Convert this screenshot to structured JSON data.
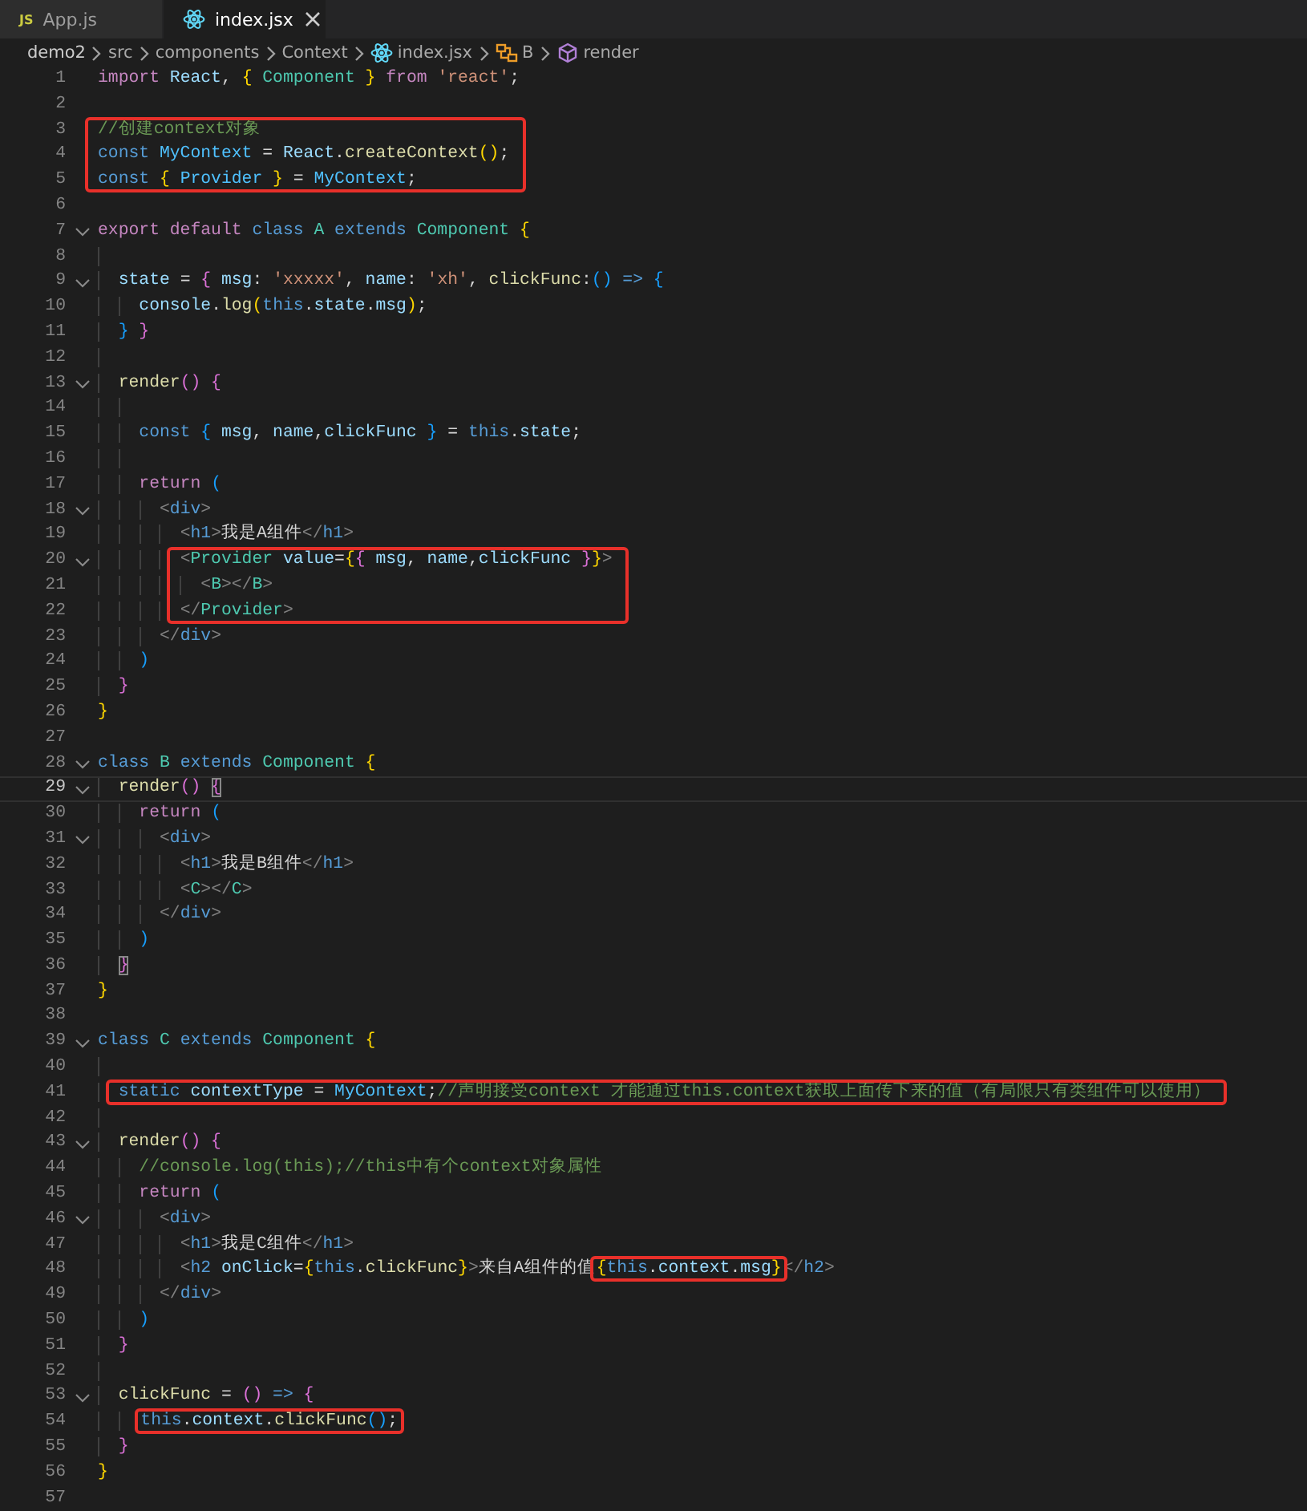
{
  "tabs": [
    {
      "kind": "js",
      "icon_text": "JS",
      "label": "App.js",
      "selected": false
    },
    {
      "kind": "react",
      "label": "index.jsx",
      "selected": true
    }
  ],
  "breadcrumb": [
    {
      "text": "demo2"
    },
    {
      "text": "src"
    },
    {
      "text": "components"
    },
    {
      "text": "Context"
    },
    {
      "kind": "react",
      "text": "index.jsx"
    },
    {
      "kind": "class",
      "text": "B"
    },
    {
      "kind": "method",
      "text": "render"
    }
  ],
  "blocks": [
    {
      "boxed": false,
      "lines": [
        {
          "number": "1",
          "tokens": [
            {
              "kind": "ctl",
              "text": "import "
            },
            {
              "kind": "var",
              "text": "React"
            },
            {
              "kind": "p",
              "text": ", "
            },
            {
              "kind": "b1",
              "text": "{ "
            },
            {
              "kind": "type",
              "text": "Component"
            },
            {
              "kind": "b1",
              "text": " }"
            },
            {
              "kind": "ctl",
              "text": " from "
            },
            {
              "kind": "str",
              "text": "'react'"
            },
            {
              "kind": "p",
              "text": ";"
            }
          ]
        },
        {
          "number": "2"
        }
      ]
    },
    {
      "boxed": true,
      "lines": [
        {
          "number": "3",
          "tokens": [
            {
              "kind": "cmt",
              "text": "//创建context对象"
            }
          ]
        },
        {
          "number": "4",
          "tokens": [
            {
              "kind": "kw",
              "text": "const "
            },
            {
              "kind": "const",
              "text": "MyContext"
            },
            {
              "kind": "p",
              "text": " = "
            },
            {
              "kind": "var",
              "text": "React"
            },
            {
              "kind": "p",
              "text": "."
            },
            {
              "kind": "fn",
              "text": "createContext"
            },
            {
              "kind": "b1",
              "text": "()"
            },
            {
              "kind": "p",
              "text": ";"
            }
          ]
        },
        {
          "number": "5",
          "tokens": [
            {
              "kind": "kw",
              "text": "const "
            },
            {
              "kind": "b1",
              "text": "{ "
            },
            {
              "kind": "const",
              "text": "Provider"
            },
            {
              "kind": "b1",
              "text": " }"
            },
            {
              "kind": "p",
              "text": " = "
            },
            {
              "kind": "const",
              "text": "MyContext"
            },
            {
              "kind": "p",
              "text": ";"
            }
          ]
        }
      ]
    },
    {
      "boxed": false,
      "lines": [
        {
          "number": "6"
        },
        {
          "number": "7",
          "foldable": true,
          "tokens": [
            {
              "kind": "ctl",
              "text": "export default "
            },
            {
              "kind": "kw",
              "text": "class "
            },
            {
              "kind": "type",
              "text": "A"
            },
            {
              "kind": "kw",
              "text": " extends "
            },
            {
              "kind": "type",
              "text": "Component"
            },
            {
              "kind": "b1",
              "text": " {"
            }
          ]
        },
        {
          "number": "8"
        },
        {
          "number": "9",
          "foldable": true,
          "tokens": [
            {
              "kind": "var",
              "text": "  state"
            },
            {
              "kind": "p",
              "text": " = "
            },
            {
              "kind": "b2",
              "text": "{ "
            },
            {
              "kind": "var",
              "text": "msg"
            },
            {
              "kind": "p",
              "text": ": "
            },
            {
              "kind": "str",
              "text": "'xxxxx'"
            },
            {
              "kind": "p",
              "text": ", "
            },
            {
              "kind": "var",
              "text": "name"
            },
            {
              "kind": "p",
              "text": ": "
            },
            {
              "kind": "str",
              "text": "'xh'"
            },
            {
              "kind": "p",
              "text": ", "
            },
            {
              "kind": "fn",
              "text": "clickFunc"
            },
            {
              "kind": "p",
              "text": ":"
            },
            {
              "kind": "b3",
              "text": "()"
            },
            {
              "kind": "kw",
              "text": " => "
            },
            {
              "kind": "b3",
              "text": "{"
            }
          ]
        },
        {
          "number": "10",
          "tokens": [
            {
              "kind": "var",
              "text": "    console"
            },
            {
              "kind": "p",
              "text": "."
            },
            {
              "kind": "fn",
              "text": "log"
            },
            {
              "kind": "b1",
              "text": "("
            },
            {
              "kind": "kw",
              "text": "this"
            },
            {
              "kind": "p",
              "text": "."
            },
            {
              "kind": "var",
              "text": "state"
            },
            {
              "kind": "p",
              "text": "."
            },
            {
              "kind": "var",
              "text": "msg"
            },
            {
              "kind": "b1",
              "text": ")"
            },
            {
              "kind": "p",
              "text": ";"
            }
          ]
        },
        {
          "number": "11",
          "tokens": [
            {
              "kind": "b3",
              "text": "  } "
            },
            {
              "kind": "b2",
              "text": "}"
            }
          ]
        },
        {
          "number": "12"
        },
        {
          "number": "13",
          "foldable": true,
          "tokens": [
            {
              "kind": "fn",
              "text": "  render"
            },
            {
              "kind": "b2",
              "text": "() {"
            }
          ]
        },
        {
          "number": "14"
        },
        {
          "number": "15",
          "tokens": [
            {
              "kind": "kw",
              "text": "    const "
            },
            {
              "kind": "b3",
              "text": "{ "
            },
            {
              "kind": "var",
              "text": "msg"
            },
            {
              "kind": "p",
              "text": ", "
            },
            {
              "kind": "var",
              "text": "name"
            },
            {
              "kind": "p",
              "text": ","
            },
            {
              "kind": "var",
              "text": "clickFunc"
            },
            {
              "kind": "b3",
              "text": " }"
            },
            {
              "kind": "p",
              "text": " = "
            },
            {
              "kind": "kw",
              "text": "this"
            },
            {
              "kind": "p",
              "text": "."
            },
            {
              "kind": "var",
              "text": "state"
            },
            {
              "kind": "p",
              "text": ";"
            }
          ]
        },
        {
          "number": "16"
        },
        {
          "number": "17",
          "tokens": [
            {
              "kind": "ctl",
              "text": "    return "
            },
            {
              "kind": "b3",
              "text": "("
            }
          ]
        },
        {
          "number": "18",
          "foldable": true,
          "tokens": [
            {
              "kind": "ang",
              "text": "      <"
            },
            {
              "kind": "tag",
              "text": "div"
            },
            {
              "kind": "ang",
              "text": ">"
            }
          ]
        },
        {
          "number": "19",
          "tokens": [
            {
              "kind": "ang",
              "text": "        <"
            },
            {
              "kind": "tag",
              "text": "h1"
            },
            {
              "kind": "ang",
              "text": ">"
            },
            {
              "kind": "text",
              "text": "我是A组件"
            },
            {
              "kind": "ang",
              "text": "</"
            },
            {
              "kind": "tag",
              "text": "h1"
            },
            {
              "kind": "ang",
              "text": ">"
            }
          ]
        }
      ]
    },
    {
      "boxed": true,
      "lines": [
        {
          "number": "20",
          "foldable": true,
          "tokens": [
            {
              "kind": "ang",
              "text": "        <"
            },
            {
              "kind": "type",
              "text": "Provider "
            },
            {
              "kind": "var",
              "text": "value"
            },
            {
              "kind": "p",
              "text": "="
            },
            {
              "kind": "b1",
              "text": "{"
            },
            {
              "kind": "b2",
              "text": "{ "
            },
            {
              "kind": "var",
              "text": "msg"
            },
            {
              "kind": "p",
              "text": ", "
            },
            {
              "kind": "var",
              "text": "name"
            },
            {
              "kind": "p",
              "text": ","
            },
            {
              "kind": "var",
              "text": "clickFunc"
            },
            {
              "kind": "b2",
              "text": " }"
            },
            {
              "kind": "b1",
              "text": "}"
            },
            {
              "kind": "ang",
              "text": ">"
            }
          ]
        },
        {
          "number": "21",
          "tokens": [
            {
              "kind": "ang",
              "text": "          <"
            },
            {
              "kind": "type",
              "text": "B"
            },
            {
              "kind": "ang",
              "text": "></"
            },
            {
              "kind": "type",
              "text": "B"
            },
            {
              "kind": "ang",
              "text": ">"
            }
          ]
        },
        {
          "number": "22",
          "tokens": [
            {
              "kind": "ang",
              "text": "        </"
            },
            {
              "kind": "type",
              "text": "Provider"
            },
            {
              "kind": "ang",
              "text": ">"
            }
          ]
        }
      ]
    },
    {
      "boxed": false,
      "lines": [
        {
          "number": "23",
          "tokens": [
            {
              "kind": "ang",
              "text": "      </"
            },
            {
              "kind": "tag",
              "text": "div"
            },
            {
              "kind": "ang",
              "text": ">"
            }
          ]
        },
        {
          "number": "24",
          "tokens": [
            {
              "kind": "b3",
              "text": "    )"
            }
          ]
        },
        {
          "number": "25",
          "tokens": [
            {
              "kind": "b2",
              "text": "  }"
            }
          ]
        },
        {
          "number": "26",
          "tokens": [
            {
              "kind": "b1",
              "text": "}"
            }
          ]
        },
        {
          "number": "27"
        },
        {
          "number": "28",
          "foldable": true,
          "tokens": [
            {
              "kind": "kw",
              "text": "class "
            },
            {
              "kind": "type",
              "text": "B"
            },
            {
              "kind": "kw",
              "text": " extends "
            },
            {
              "kind": "type",
              "text": "Component"
            },
            {
              "kind": "b1",
              "text": " {"
            }
          ]
        },
        {
          "number": "29",
          "foldable": true,
          "current": true,
          "tokens": [
            {
              "kind": "fn",
              "text": "  render"
            },
            {
              "kind": "b2",
              "text": "() "
            },
            {
              "kind": "b2",
              "text": "{",
              "matched": true
            }
          ]
        },
        {
          "number": "30",
          "tokens": [
            {
              "kind": "ctl",
              "text": "    return "
            },
            {
              "kind": "b3",
              "text": "("
            }
          ]
        },
        {
          "number": "31",
          "foldable": true,
          "tokens": [
            {
              "kind": "ang",
              "text": "      <"
            },
            {
              "kind": "tag",
              "text": "div"
            },
            {
              "kind": "ang",
              "text": ">"
            }
          ]
        },
        {
          "number": "32",
          "tokens": [
            {
              "kind": "ang",
              "text": "        <"
            },
            {
              "kind": "tag",
              "text": "h1"
            },
            {
              "kind": "ang",
              "text": ">"
            },
            {
              "kind": "text",
              "text": "我是B组件"
            },
            {
              "kind": "ang",
              "text": "</"
            },
            {
              "kind": "tag",
              "text": "h1"
            },
            {
              "kind": "ang",
              "text": ">"
            }
          ]
        },
        {
          "number": "33",
          "tokens": [
            {
              "kind": "ang",
              "text": "        <"
            },
            {
              "kind": "type",
              "text": "C"
            },
            {
              "kind": "ang",
              "text": "></"
            },
            {
              "kind": "type",
              "text": "C"
            },
            {
              "kind": "ang",
              "text": ">"
            }
          ]
        },
        {
          "number": "34",
          "tokens": [
            {
              "kind": "ang",
              "text": "      </"
            },
            {
              "kind": "tag",
              "text": "div"
            },
            {
              "kind": "ang",
              "text": ">"
            }
          ]
        },
        {
          "number": "35",
          "tokens": [
            {
              "kind": "b3",
              "text": "    )"
            }
          ]
        },
        {
          "number": "36",
          "tokens": [
            {
              "kind": "b2",
              "text": "  }",
              "matched": true
            }
          ]
        },
        {
          "number": "37",
          "tokens": [
            {
              "kind": "b1",
              "text": "}"
            }
          ]
        },
        {
          "number": "38"
        },
        {
          "number": "39",
          "foldable": true,
          "tokens": [
            {
              "kind": "kw",
              "text": "class "
            },
            {
              "kind": "type",
              "text": "C"
            },
            {
              "kind": "kw",
              "text": " extends "
            },
            {
              "kind": "type",
              "text": "Component"
            },
            {
              "kind": "b1",
              "text": " {"
            }
          ]
        },
        {
          "number": "40"
        }
      ]
    },
    {
      "boxed": true,
      "lines": [
        {
          "number": "41",
          "tokens": [
            {
              "kind": "kw",
              "text": "  static "
            },
            {
              "kind": "var",
              "text": "contextType"
            },
            {
              "kind": "p",
              "text": " = "
            },
            {
              "kind": "const",
              "text": "MyContext"
            },
            {
              "kind": "p",
              "text": ";"
            },
            {
              "kind": "cmt",
              "text": "//声明接受context 才能通过this.context获取上面传下来的值（有局限只有类组件可以使用）"
            }
          ]
        }
      ]
    },
    {
      "boxed": false,
      "lines": [
        {
          "number": "42"
        },
        {
          "number": "43",
          "foldable": true,
          "tokens": [
            {
              "kind": "fn",
              "text": "  render"
            },
            {
              "kind": "b2",
              "text": "() {"
            }
          ]
        },
        {
          "number": "44",
          "tokens": [
            {
              "kind": "cmt",
              "text": "    //console.log(this);//this中有个context对象属性"
            }
          ]
        },
        {
          "number": "45",
          "tokens": [
            {
              "kind": "ctl",
              "text": "    return "
            },
            {
              "kind": "b3",
              "text": "("
            }
          ]
        },
        {
          "number": "46",
          "foldable": true,
          "tokens": [
            {
              "kind": "ang",
              "text": "      <"
            },
            {
              "kind": "tag",
              "text": "div"
            },
            {
              "kind": "ang",
              "text": ">"
            }
          ]
        },
        {
          "number": "47",
          "tokens": [
            {
              "kind": "ang",
              "text": "        <"
            },
            {
              "kind": "tag",
              "text": "h1"
            },
            {
              "kind": "ang",
              "text": ">"
            },
            {
              "kind": "text",
              "text": "我是C组件"
            },
            {
              "kind": "ang",
              "text": "</"
            },
            {
              "kind": "tag",
              "text": "h1"
            },
            {
              "kind": "ang",
              "text": ">"
            }
          ]
        },
        {
          "number": "48",
          "tokens": [
            {
              "kind": "ang",
              "text": "        <"
            },
            {
              "kind": "tag",
              "text": "h2 "
            },
            {
              "kind": "var",
              "text": "onClick"
            },
            {
              "kind": "p",
              "text": "="
            },
            {
              "kind": "b1",
              "text": "{"
            },
            {
              "kind": "kw",
              "text": "this"
            },
            {
              "kind": "p",
              "text": "."
            },
            {
              "kind": "fn",
              "text": "clickFunc"
            },
            {
              "kind": "b1",
              "text": "}"
            },
            {
              "kind": "ang",
              "text": ">"
            },
            {
              "kind": "text",
              "text": "来自A组件的值"
            },
            {
              "kind": "group",
              "boxed": true,
              "tokens": [
                {
                  "kind": "b1",
                  "text": "{"
                },
                {
                  "kind": "kw",
                  "text": "this"
                },
                {
                  "kind": "p",
                  "text": "."
                },
                {
                  "kind": "var",
                  "text": "context"
                },
                {
                  "kind": "p",
                  "text": "."
                },
                {
                  "kind": "var",
                  "text": "msg"
                },
                {
                  "kind": "b1",
                  "text": "}"
                }
              ]
            },
            {
              "kind": "ang",
              "text": "</"
            },
            {
              "kind": "tag",
              "text": "h2"
            },
            {
              "kind": "ang",
              "text": ">"
            }
          ]
        },
        {
          "number": "49",
          "tokens": [
            {
              "kind": "ang",
              "text": "      </"
            },
            {
              "kind": "tag",
              "text": "div"
            },
            {
              "kind": "ang",
              "text": ">"
            }
          ]
        },
        {
          "number": "50",
          "tokens": [
            {
              "kind": "b3",
              "text": "    )"
            }
          ]
        },
        {
          "number": "51",
          "tokens": [
            {
              "kind": "b2",
              "text": "  }"
            }
          ]
        },
        {
          "number": "52"
        },
        {
          "number": "53",
          "foldable": true,
          "tokens": [
            {
              "kind": "fn",
              "text": "  clickFunc"
            },
            {
              "kind": "p",
              "text": " = "
            },
            {
              "kind": "b2",
              "text": "()"
            },
            {
              "kind": "kw",
              "text": " => "
            },
            {
              "kind": "b2",
              "text": "{"
            }
          ]
        },
        {
          "number": "54",
          "tokens": [
            {
              "kind": "group",
              "boxed": true,
              "tokens": [
                {
                  "kind": "kw",
                  "text": "    this"
                },
                {
                  "kind": "p",
                  "text": "."
                },
                {
                  "kind": "var",
                  "text": "context"
                },
                {
                  "kind": "p",
                  "text": "."
                },
                {
                  "kind": "fn",
                  "text": "clickFunc"
                },
                {
                  "kind": "b3",
                  "text": "()"
                },
                {
                  "kind": "p",
                  "text": ";"
                }
              ]
            }
          ]
        },
        {
          "number": "55",
          "tokens": [
            {
              "kind": "b2",
              "text": "  }"
            }
          ]
        },
        {
          "number": "56",
          "tokens": [
            {
              "kind": "b1",
              "text": "}"
            }
          ]
        },
        {
          "number": "57"
        }
      ]
    }
  ]
}
